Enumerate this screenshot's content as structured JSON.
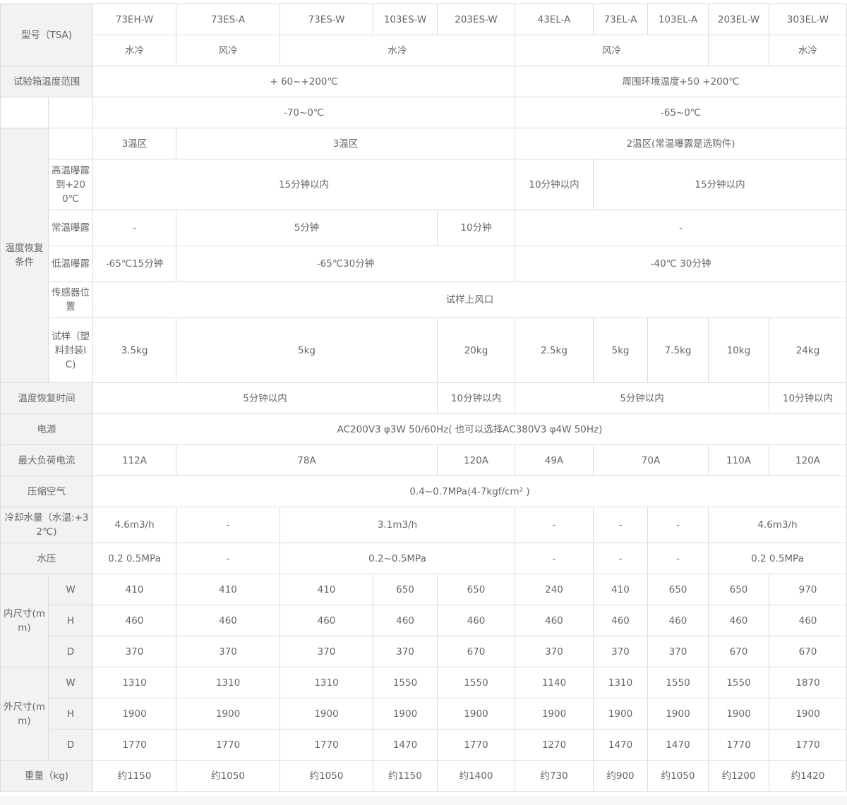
{
  "models": [
    "73EH-W",
    "73ES-A",
    "73ES-W",
    "103ES-W",
    "203ES-W",
    "43EL-A",
    "73EL-A",
    "103EL-A",
    "203EL-W",
    "303EL-W"
  ],
  "labels": {
    "model": "型号（TSA)",
    "chamber_temp": "试验箱温度范围",
    "recovery": "温度恢复条件",
    "high_exposure": "高温曝露到+200℃",
    "normal_exposure": "常温曝露",
    "low_exposure": "低温曝露",
    "sensor": "传感器位置",
    "sample": "试样（塑料封装IC)",
    "recovery_time": "温度恢复时间",
    "power": "电源",
    "max_current": "最大负荷电流",
    "air": "压缩空气",
    "cooling_water": "冷却水量（水温:+32℃)",
    "water_pressure": "水压",
    "inner": "内尺寸(mm)",
    "outer": "外尺寸(mm)",
    "w": "W",
    "h": "H",
    "d": "D",
    "weight": "重量（kg)"
  },
  "cooling": [
    "水冷",
    "风冷",
    "水冷",
    "风冷",
    "",
    "水冷"
  ],
  "chamber_temp": [
    "+ 60~+200℃",
    "周围环境温度+50 +200℃"
  ],
  "low_range": [
    "-70~0℃",
    "-65~0℃"
  ],
  "zones": [
    "3温区",
    "3温区",
    "2温区(常温曝露是选购件)"
  ],
  "high_exposure": [
    "15分钟以内",
    "10分钟以内",
    "15分钟以内"
  ],
  "normal_exposure": [
    "-",
    "5分钟",
    "10分钟",
    "-"
  ],
  "low_exposure": [
    "-65℃15分钟",
    "-65℃30分钟",
    "-40℃ 30分钟"
  ],
  "sensor": "试样上风口",
  "sample": [
    "3.5kg",
    "5kg",
    "20kg",
    "2.5kg",
    "5kg",
    "7.5kg",
    "10kg",
    "24kg"
  ],
  "recovery_time": [
    "5分钟以内",
    "10分钟以内",
    "5分钟以内",
    "10分钟以内"
  ],
  "power": "AC200V3 φ3W 50/60Hz( 也可以选择AC380V3 φ4W 50Hz)",
  "max_current": [
    "112A",
    "78A",
    "120A",
    "49A",
    "70A",
    "110A",
    "120A"
  ],
  "air": "0.4~0.7MPa(4-7kgf/cm² )",
  "cooling_water": [
    "4.6m3/h",
    "-",
    "3.1m3/h",
    "-",
    "-",
    "-",
    "4.6m3/h"
  ],
  "water_pressure": [
    "0.2 0.5MPa",
    "-",
    "0.2~0.5MPa",
    "-",
    "-",
    "-",
    "0.2 0.5MPa"
  ],
  "inner": {
    "w": [
      "410",
      "410",
      "410",
      "650",
      "650",
      "240",
      "410",
      "650",
      "650",
      "970"
    ],
    "h": [
      "460",
      "460",
      "460",
      "460",
      "460",
      "460",
      "460",
      "460",
      "460",
      "460"
    ],
    "d": [
      "370",
      "370",
      "370",
      "370",
      "670",
      "370",
      "370",
      "370",
      "670",
      "670"
    ]
  },
  "outer": {
    "w": [
      "1310",
      "1310",
      "1310",
      "1550",
      "1550",
      "1140",
      "1310",
      "1550",
      "1550",
      "1870"
    ],
    "h": [
      "1900",
      "1900",
      "1900",
      "1900",
      "1900",
      "1900",
      "1900",
      "1900",
      "1900",
      "1900"
    ],
    "d": [
      "1770",
      "1770",
      "1770",
      "1470",
      "1770",
      "1270",
      "1470",
      "1470",
      "1770",
      "1770"
    ]
  },
  "weight": [
    "约1150",
    "约1050",
    "约1050",
    "约1150",
    "约1400",
    "约730",
    "约900",
    "约1050",
    "约1200",
    "约1420"
  ]
}
